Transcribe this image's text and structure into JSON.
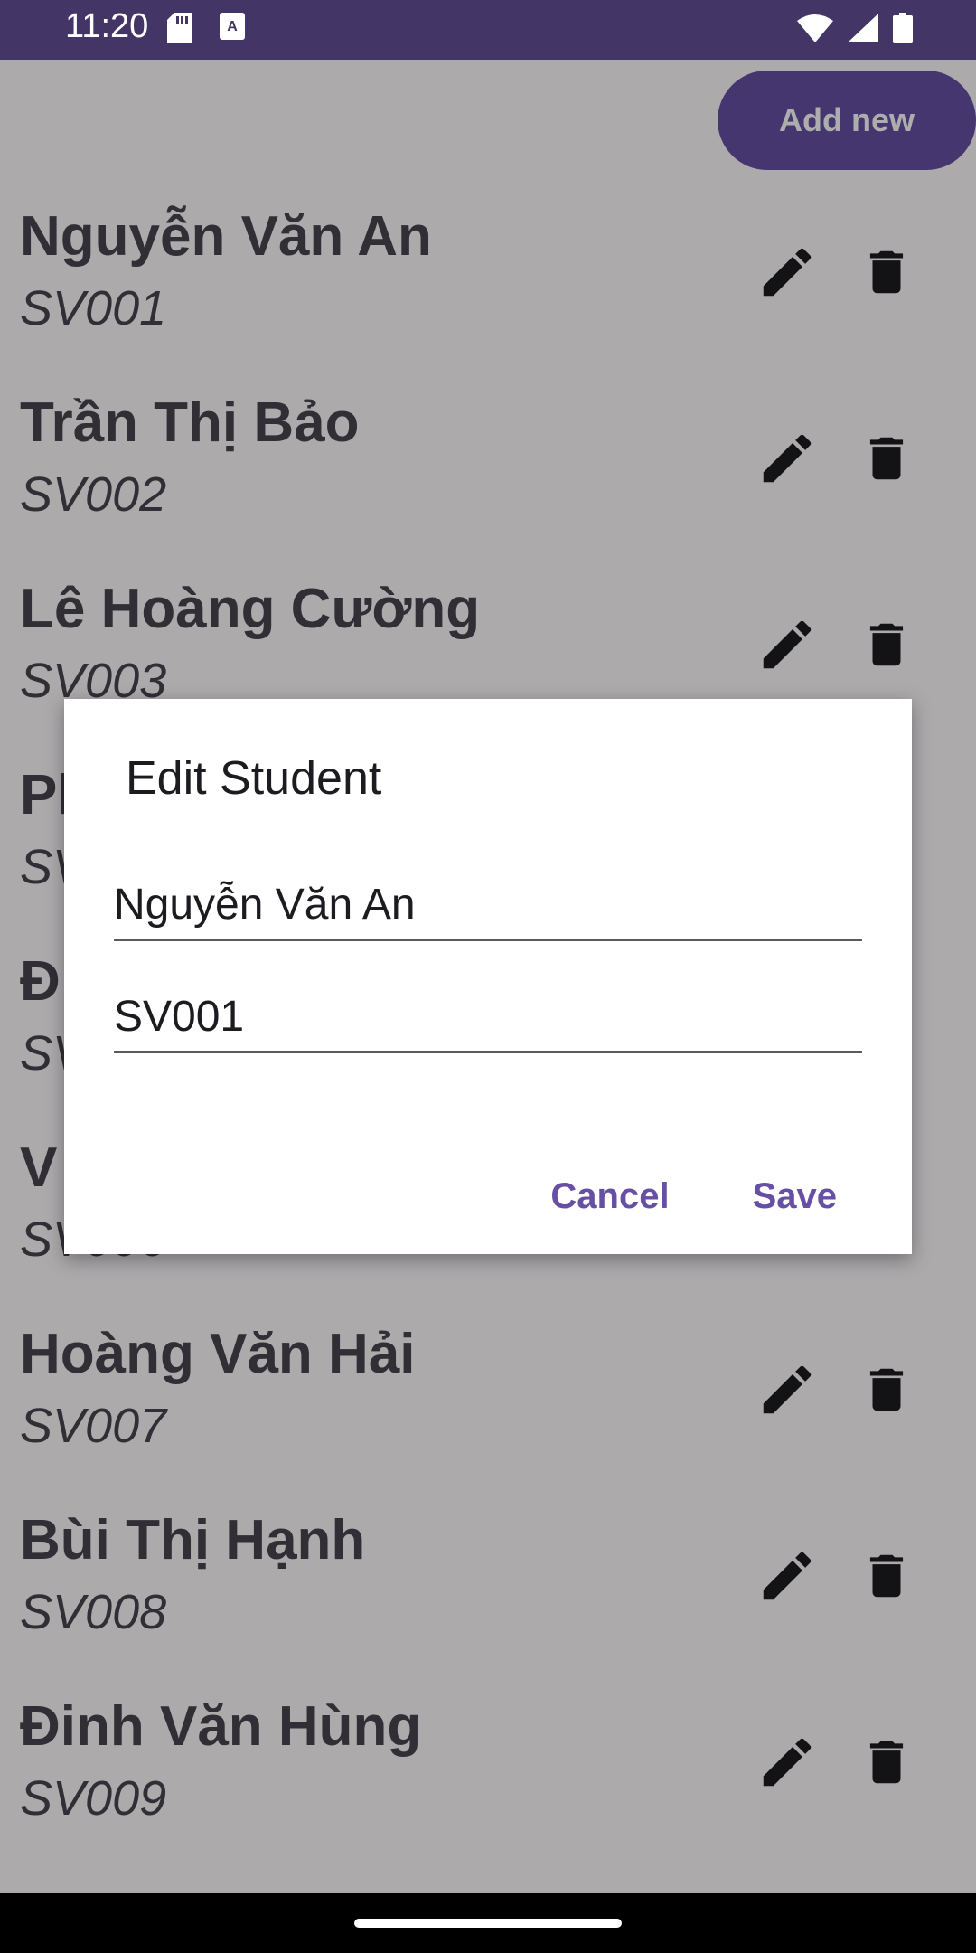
{
  "status_bar": {
    "time": "11:20"
  },
  "header": {
    "add_label": "Add new"
  },
  "students": [
    {
      "name": "Nguyễn Văn An",
      "code": "SV001"
    },
    {
      "name": "Trần Thị Bảo",
      "code": "SV002"
    },
    {
      "name": "Lê Hoàng Cường",
      "code": "SV003"
    },
    {
      "name": "Ph",
      "code": "SV"
    },
    {
      "name": "Đ",
      "code": "SV"
    },
    {
      "name": "V",
      "code": "SV006"
    },
    {
      "name": "Hoàng Văn Hải",
      "code": "SV007"
    },
    {
      "name": "Bùi Thị Hạnh",
      "code": "SV008"
    },
    {
      "name": "Đinh Văn Hùng",
      "code": "SV009"
    }
  ],
  "dialog": {
    "title": "Edit Student",
    "name_value": "Nguyễn Văn An",
    "code_value": "SV001",
    "cancel_label": "Cancel",
    "save_label": "Save"
  },
  "colors": {
    "primary": "#6750a4",
    "status_bar": "#433566",
    "scrim": "rgba(0,0,0,0.32)"
  },
  "icons": {
    "edit": "pencil-icon",
    "delete": "trash-icon",
    "sd": "sd-card-icon",
    "keyboard": "text-input-icon",
    "wifi": "wifi-icon",
    "signal": "signal-icon",
    "battery": "battery-icon"
  }
}
